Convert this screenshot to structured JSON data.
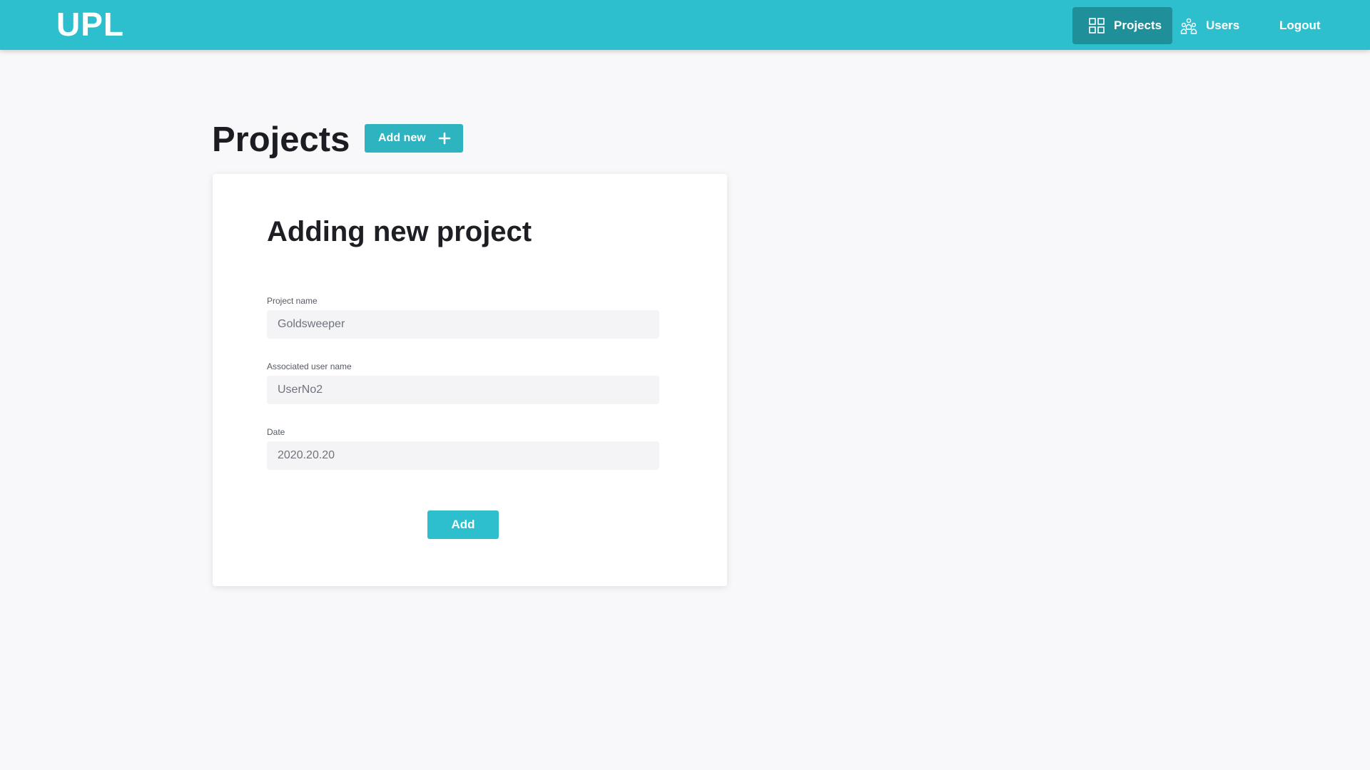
{
  "header": {
    "logo": "UPL",
    "nav": [
      {
        "label": "Projects",
        "icon": "grid-icon",
        "active": true
      },
      {
        "label": "Users",
        "icon": "users-icon",
        "active": false
      },
      {
        "label": "Logout",
        "icon": "",
        "active": false
      }
    ]
  },
  "page": {
    "title": "Projects",
    "add_new_label": "Add new",
    "add_new_icon": "plus-icon"
  },
  "form": {
    "title": "Adding new project",
    "fields": [
      {
        "label": "Project name",
        "value": "Goldsweeper"
      },
      {
        "label": "Associated user name",
        "value": "UserNo2"
      },
      {
        "label": "Date",
        "value": "2020.20.20"
      }
    ],
    "submit_label": "Add"
  },
  "colors": {
    "topbar": "#2ebfce",
    "nav_active": "#1f8f9a",
    "button": "#2eb3c1",
    "page_bg": "#f8f8fa",
    "input_bg": "#f4f4f7"
  }
}
